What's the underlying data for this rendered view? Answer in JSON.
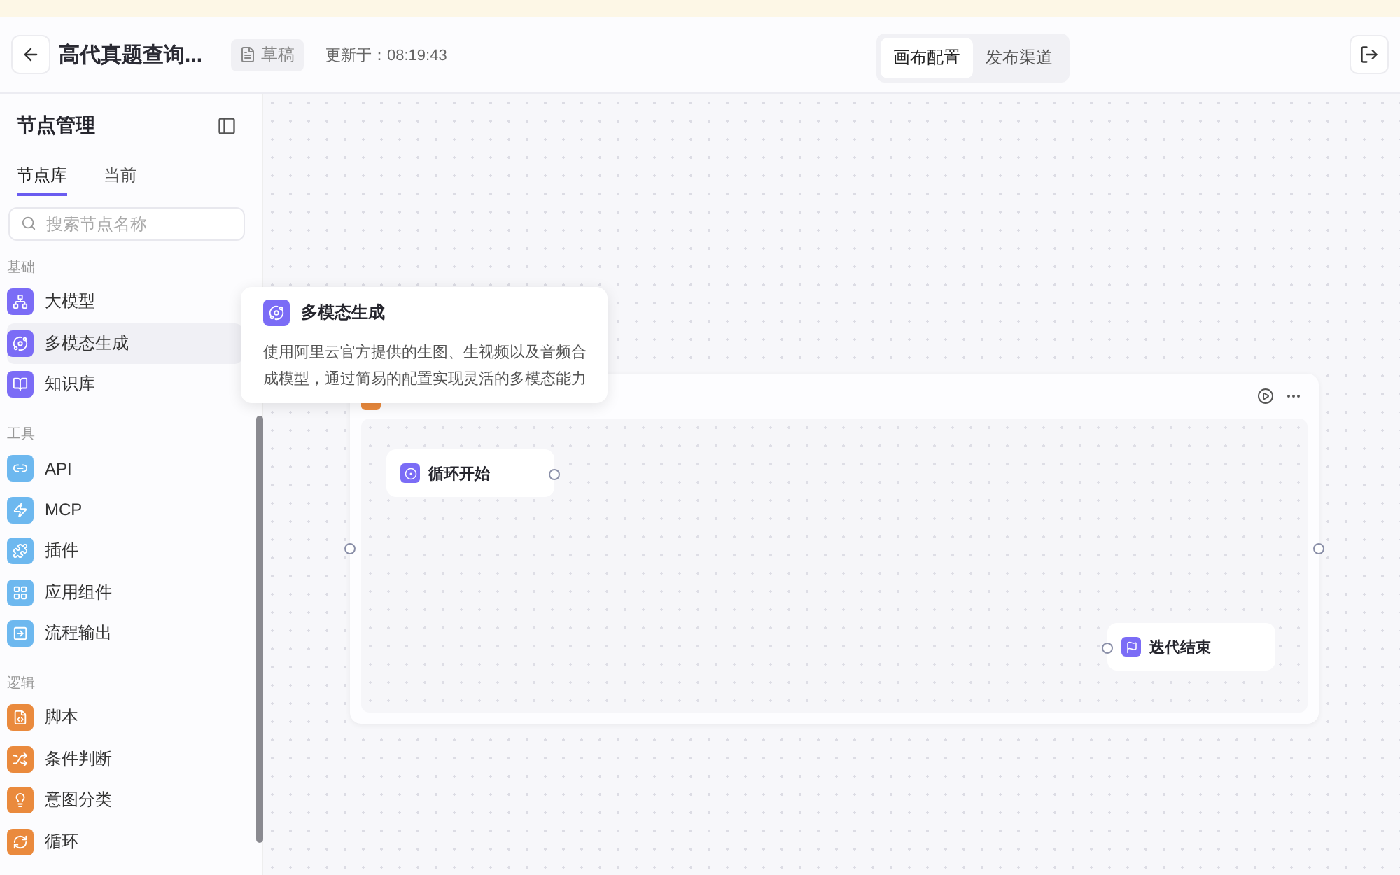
{
  "header": {
    "title": "高代真题查询...",
    "status": "草稿",
    "updated": "更新于：08:19:43",
    "tabs": [
      {
        "label": "画布配置",
        "selected": true
      },
      {
        "label": "发布渠道",
        "selected": false
      }
    ]
  },
  "sidebar": {
    "title": "节点管理",
    "tabs": [
      {
        "label": "节点库",
        "selected": true
      },
      {
        "label": "当前",
        "selected": false
      }
    ],
    "search": {
      "placeholder": "搜索节点名称"
    },
    "groups": [
      {
        "label": "基础",
        "color": "#7b6cf6",
        "items": [
          {
            "label": "大模型",
            "highlighted": false
          },
          {
            "label": "多模态生成",
            "highlighted": true
          },
          {
            "label": "知识库",
            "highlighted": false
          }
        ]
      },
      {
        "label": "工具",
        "color": "#6db8ef",
        "items": [
          {
            "label": "API",
            "highlighted": false
          },
          {
            "label": "MCP",
            "highlighted": false
          },
          {
            "label": "插件",
            "highlighted": false
          },
          {
            "label": "应用组件",
            "highlighted": false
          },
          {
            "label": "流程输出",
            "highlighted": false
          }
        ]
      },
      {
        "label": "逻辑",
        "color": "#ea8a3d",
        "items": [
          {
            "label": "脚本",
            "highlighted": false
          },
          {
            "label": "条件判断",
            "highlighted": false
          },
          {
            "label": "意图分类",
            "highlighted": false
          },
          {
            "label": "循环",
            "highlighted": false
          }
        ]
      }
    ]
  },
  "tooltip": {
    "title": "多模态生成",
    "description": "使用阿里云官方提供的生图、生视频以及音频合成模型，通过简易的配置实现灵活的多模态能力"
  },
  "canvas": {
    "loop": {
      "nodes": [
        {
          "label": "循环开始",
          "kind": "start"
        },
        {
          "label": "迭代结束",
          "kind": "end"
        }
      ]
    }
  }
}
